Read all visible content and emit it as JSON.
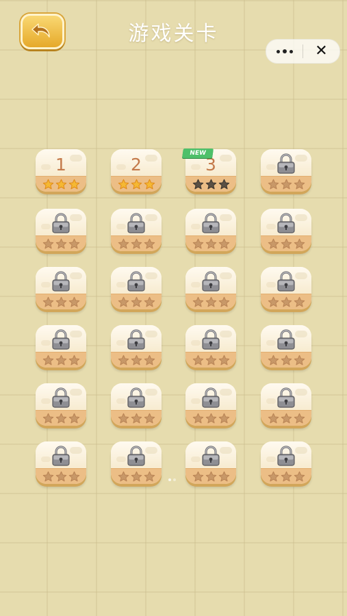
{
  "header": {
    "title": "游戏关卡"
  },
  "capsule": {
    "more_icon": "more-dots-icon",
    "close_icon": "close-icon",
    "close_glyph": "✕"
  },
  "colors": {
    "background": "#e6dcae",
    "star_gold": "#f5b833",
    "star_earned_dark": "#5b5044",
    "star_locked": "#c89868",
    "new_badge": "#4ec06a"
  },
  "levels": [
    {
      "label": "1",
      "state": "completed",
      "stars": 3
    },
    {
      "label": "2",
      "state": "completed",
      "stars": 3
    },
    {
      "label": "3",
      "state": "current",
      "stars": 0,
      "badge": "NEW"
    },
    {
      "label": "",
      "state": "locked",
      "stars": 0
    },
    {
      "label": "",
      "state": "locked",
      "stars": 0
    },
    {
      "label": "",
      "state": "locked",
      "stars": 0
    },
    {
      "label": "",
      "state": "locked",
      "stars": 0
    },
    {
      "label": "",
      "state": "locked",
      "stars": 0
    },
    {
      "label": "",
      "state": "locked",
      "stars": 0
    },
    {
      "label": "",
      "state": "locked",
      "stars": 0
    },
    {
      "label": "",
      "state": "locked",
      "stars": 0
    },
    {
      "label": "",
      "state": "locked",
      "stars": 0
    },
    {
      "label": "",
      "state": "locked",
      "stars": 0
    },
    {
      "label": "",
      "state": "locked",
      "stars": 0
    },
    {
      "label": "",
      "state": "locked",
      "stars": 0
    },
    {
      "label": "",
      "state": "locked",
      "stars": 0
    },
    {
      "label": "",
      "state": "locked",
      "stars": 0
    },
    {
      "label": "",
      "state": "locked",
      "stars": 0
    },
    {
      "label": "",
      "state": "locked",
      "stars": 0
    },
    {
      "label": "",
      "state": "locked",
      "stars": 0
    },
    {
      "label": "",
      "state": "locked",
      "stars": 0
    },
    {
      "label": "",
      "state": "locked",
      "stars": 0
    },
    {
      "label": "",
      "state": "locked",
      "stars": 0
    },
    {
      "label": "",
      "state": "locked",
      "stars": 0
    }
  ],
  "pager": {
    "pages": 2,
    "current": 1
  }
}
